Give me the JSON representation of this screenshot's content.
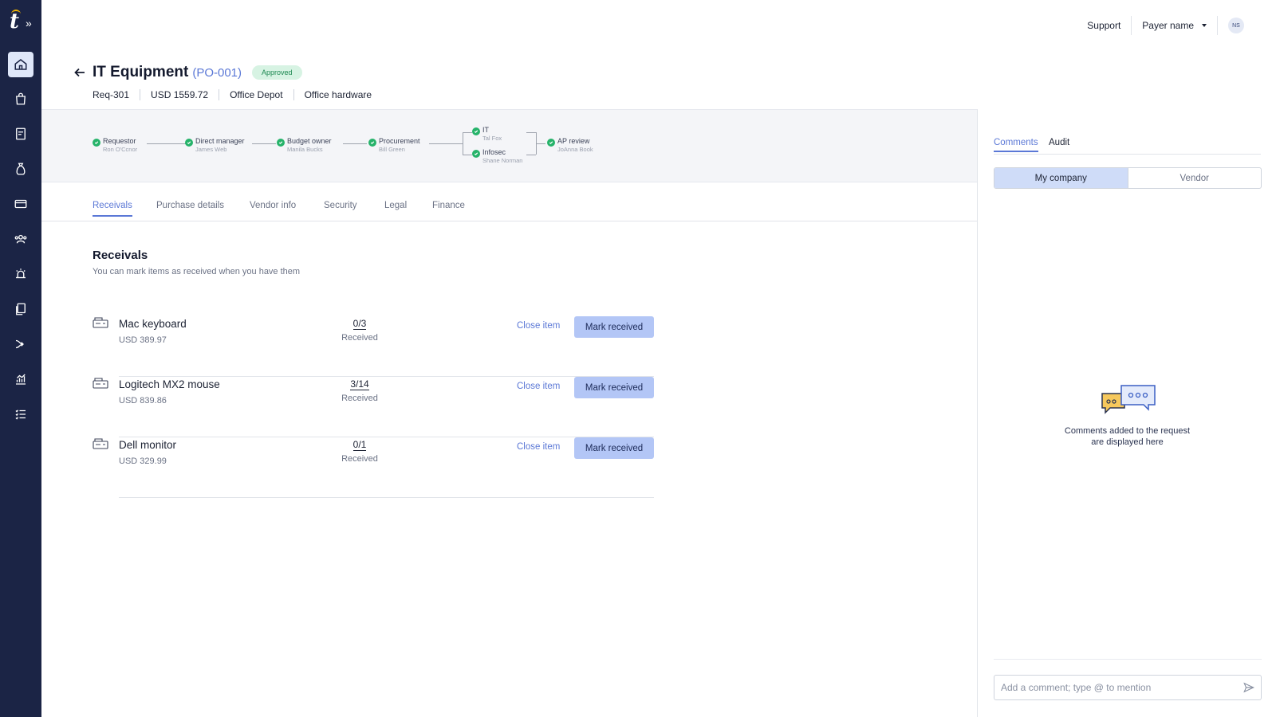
{
  "brand": {
    "logo_letter": "t",
    "expand_icon": "chevron-double-right-icon"
  },
  "sidebar": {
    "items": [
      {
        "icon": "home-icon",
        "active": true
      },
      {
        "icon": "shopping-bag-icon",
        "active": false
      },
      {
        "icon": "invoice-icon",
        "active": false
      },
      {
        "icon": "money-bag-icon",
        "active": false
      },
      {
        "icon": "credit-card-icon",
        "active": false
      },
      {
        "icon": "users-icon",
        "active": false
      },
      {
        "icon": "alarm-icon",
        "active": false
      },
      {
        "icon": "documents-icon",
        "active": false
      },
      {
        "icon": "flow-icon",
        "active": false
      },
      {
        "icon": "chart-icon",
        "active": false
      },
      {
        "icon": "checklist-icon",
        "active": false
      }
    ]
  },
  "topbar": {
    "support": "Support",
    "payer": "Payer name",
    "avatar_initials": "NS"
  },
  "header": {
    "title": "IT Equipment",
    "po_code": "(PO-001)",
    "status": "Approved",
    "meta": [
      "Req-301",
      "USD 1559.72",
      "Office Depot",
      "Office hardware"
    ]
  },
  "workflow": {
    "steps": [
      {
        "role": "Requestor",
        "name": "Ron O'Ccnor"
      },
      {
        "role": "Direct manager",
        "name": "James Web"
      },
      {
        "role": "Budget owner",
        "name": "Manila Bucks"
      },
      {
        "role": "Procurement",
        "name": "Bill Green"
      },
      {
        "role": "IT",
        "name": "Tal Fox"
      },
      {
        "role": "Infosec",
        "name": "Shane Norman"
      },
      {
        "role": "AP review",
        "name": "JoAnna Book"
      }
    ]
  },
  "tabs": [
    "Receivals",
    "Purchase details",
    "Vendor info",
    "Security",
    "Legal",
    "Finance"
  ],
  "receivals": {
    "title": "Receivals",
    "subtitle": "You can mark items as received when you have them",
    "received_label": "Received",
    "close_label": "Close item",
    "mark_label": "Mark received",
    "items": [
      {
        "name": "Mac keyboard",
        "price": "USD 389.97",
        "count": "0/3"
      },
      {
        "name": "Logitech MX2 mouse",
        "price": "USD 839.86",
        "count": "3/14"
      },
      {
        "name": "Dell monitor",
        "price": "USD 329.99",
        "count": "0/1"
      }
    ]
  },
  "comments_panel": {
    "tabs": [
      "Comments",
      "Audit"
    ],
    "segments": [
      "My company",
      "Vendor"
    ],
    "empty_text": "Comments added to the request are displayed here",
    "input_placeholder": "Add a comment; type @ to mention"
  },
  "colors": {
    "sidebar_bg": "#1b2445",
    "accent": "#5b78d6",
    "approved_bg": "#d7f3e3",
    "approved_text": "#1f8a53",
    "button_bg": "#b3c6f6",
    "check_green": "#26b36a"
  }
}
